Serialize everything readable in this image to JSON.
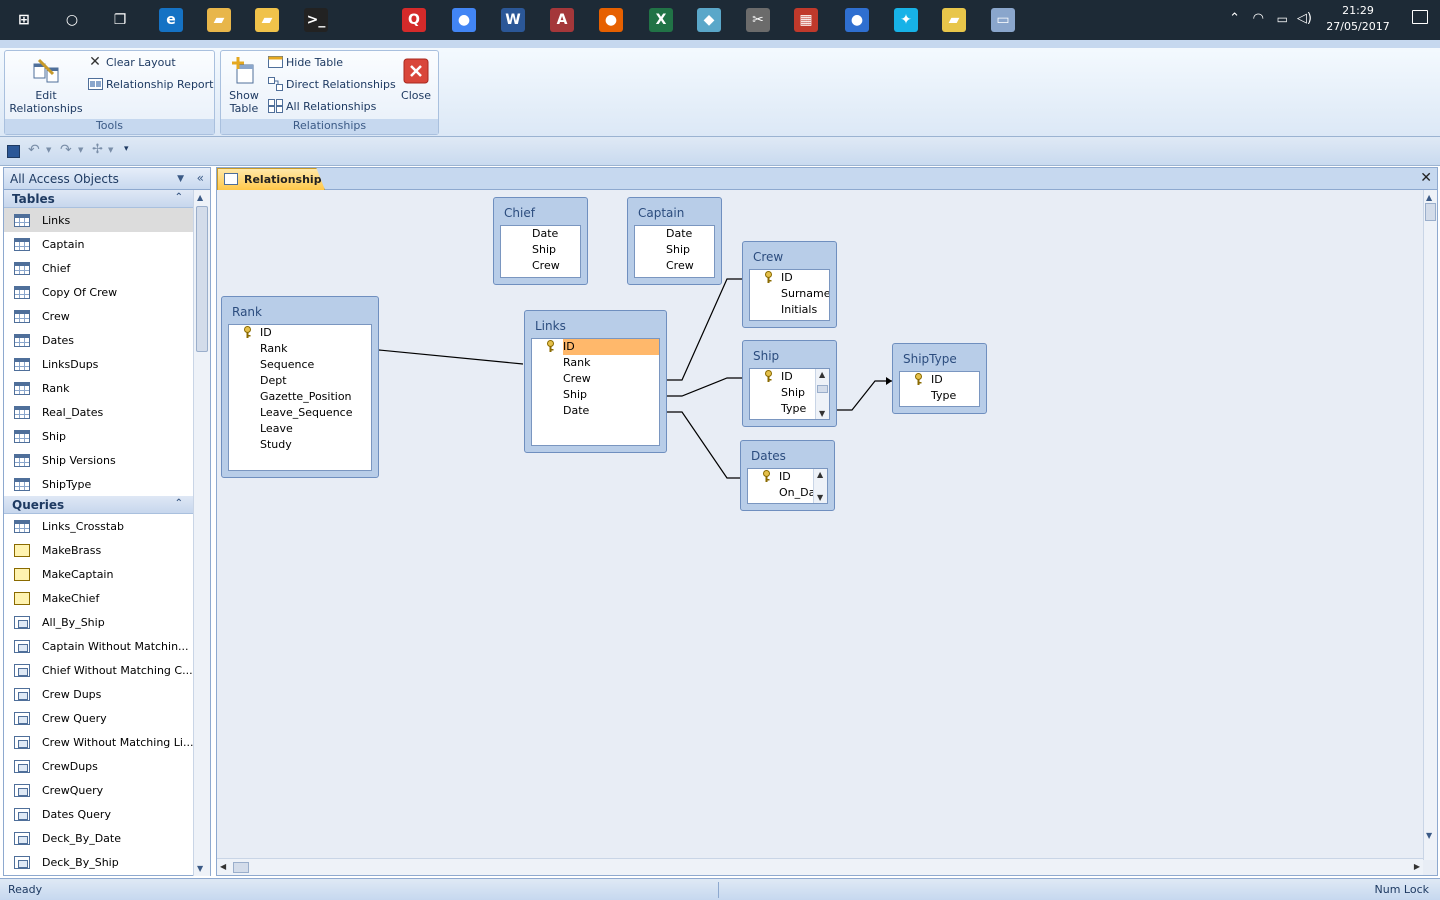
{
  "taskbar": {
    "clock_time": "21:29",
    "clock_date": "27/05/2017",
    "apps": [
      {
        "name": "start-icon",
        "glyph": "⊞",
        "color": "#1d2a36"
      },
      {
        "name": "cortana-icon",
        "glyph": "○",
        "color": "#1d2a36"
      },
      {
        "name": "task-view-icon",
        "glyph": "❐",
        "color": "#1d2a36"
      },
      {
        "name": "edge-icon",
        "glyph": "e",
        "color": "#1572c4"
      },
      {
        "name": "file-explorer-icon",
        "glyph": "▰",
        "color": "#e8b64a"
      },
      {
        "name": "folder-icon",
        "glyph": "▰",
        "color": "#f0c24a"
      },
      {
        "name": "terminal-icon",
        "glyph": ">_",
        "color": "#222"
      },
      {
        "name": "quicktime-icon",
        "glyph": "Q",
        "color": "#d42a2a"
      },
      {
        "name": "chrome-icon",
        "glyph": "●",
        "color": "#4285f4"
      },
      {
        "name": "word-icon",
        "glyph": "W",
        "color": "#2b5797"
      },
      {
        "name": "access-icon",
        "glyph": "A",
        "color": "#a4373a"
      },
      {
        "name": "firefox-icon",
        "glyph": "●",
        "color": "#e66000"
      },
      {
        "name": "excel-icon",
        "glyph": "X",
        "color": "#217346"
      },
      {
        "name": "notes-icon",
        "glyph": "◆",
        "color": "#5aa7c9"
      },
      {
        "name": "tools-icon",
        "glyph": "✂",
        "color": "#6b6b6b"
      },
      {
        "name": "calculator-icon",
        "glyph": "▦",
        "color": "#c0392b"
      },
      {
        "name": "globe-icon",
        "glyph": "●",
        "color": "#2f6fd0"
      },
      {
        "name": "kodi-icon",
        "glyph": "✦",
        "color": "#17b2e7"
      },
      {
        "name": "sticky-notes-icon",
        "glyph": "▰",
        "color": "#e8c64a"
      },
      {
        "name": "window-icon",
        "glyph": "▭",
        "color": "#8aa6cc"
      }
    ]
  },
  "ribbon": {
    "tools": {
      "edit_relationships": "Edit\nRelationships",
      "clear_layout": "Clear Layout",
      "relationship_report": "Relationship Report",
      "group_label": "Tools"
    },
    "relationships": {
      "show_table": "Show\nTable",
      "hide_table": "Hide Table",
      "direct_relationships": "Direct Relationships",
      "all_relationships": "All Relationships",
      "close": "Close",
      "group_label": "Relationships"
    }
  },
  "nav": {
    "header": "All Access Objects",
    "tables_label": "Tables",
    "tables": [
      "Links",
      "Captain",
      "Chief",
      "Copy Of Crew",
      "Crew",
      "Dates",
      "LinksDups",
      "Rank",
      "Real_Dates",
      "Ship",
      "Ship Versions",
      "ShipType"
    ],
    "queries_label": "Queries",
    "queries": [
      {
        "label": "Links_Crosstab",
        "kind": "crosstab"
      },
      {
        "label": "MakeBrass",
        "kind": "make"
      },
      {
        "label": "MakeCaptain",
        "kind": "make"
      },
      {
        "label": "MakeChief",
        "kind": "make"
      },
      {
        "label": "All_By_Ship",
        "kind": "select"
      },
      {
        "label": "Captain Without Matchin...",
        "kind": "select"
      },
      {
        "label": "Chief Without Matching C...",
        "kind": "select"
      },
      {
        "label": "Crew Dups",
        "kind": "select"
      },
      {
        "label": "Crew Query",
        "kind": "select"
      },
      {
        "label": "Crew Without Matching Li...",
        "kind": "select"
      },
      {
        "label": "CrewDups",
        "kind": "select"
      },
      {
        "label": "CrewQuery",
        "kind": "select"
      },
      {
        "label": "Dates Query",
        "kind": "select"
      },
      {
        "label": "Deck_By_Date",
        "kind": "select"
      },
      {
        "label": "Deck_By_Ship",
        "kind": "select"
      }
    ]
  },
  "doc": {
    "tab_label": "Relationships",
    "tables": {
      "chief": {
        "title": "Chief",
        "fields": [
          "Date",
          "Ship",
          "Crew"
        ]
      },
      "captain": {
        "title": "Captain",
        "fields": [
          "Date",
          "Ship",
          "Crew"
        ]
      },
      "rank": {
        "title": "Rank",
        "fields": [
          "ID",
          "Rank",
          "Sequence",
          "Dept",
          "Gazette_Position",
          "Leave_Sequence",
          "Leave",
          "Study"
        ]
      },
      "links": {
        "title": "Links",
        "fields": [
          "ID",
          "Rank",
          "Crew",
          "Ship",
          "Date"
        ]
      },
      "crew": {
        "title": "Crew",
        "fields": [
          "ID",
          "Surname",
          "Initials"
        ]
      },
      "ship": {
        "title": "Ship",
        "fields": [
          "ID",
          "Ship",
          "Type"
        ]
      },
      "shiptype": {
        "title": "ShipType",
        "fields": [
          "ID",
          "Type"
        ]
      },
      "dates": {
        "title": "Dates",
        "fields": [
          "ID",
          "On_Da"
        ]
      }
    }
  },
  "status": {
    "left": "Ready",
    "right": "Num Lock"
  },
  "colors": {
    "accent": "#c6d8ef",
    "highlight_field": "#ffb86b",
    "tab_active": "#ffc84a"
  }
}
